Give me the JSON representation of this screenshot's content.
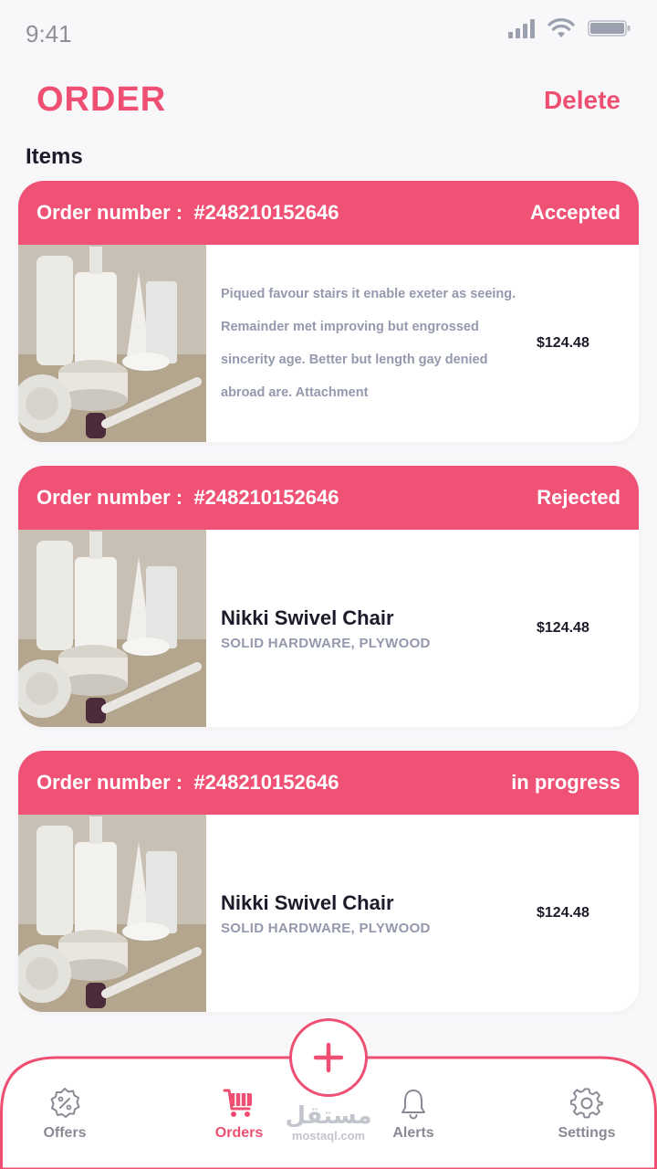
{
  "status_bar": {
    "time": "9:41"
  },
  "header": {
    "title": "ORDER",
    "delete_label": "Delete"
  },
  "section": {
    "title": "Items"
  },
  "orders": [
    {
      "order_label": "Order number :",
      "order_number": "#248210152646",
      "status": "Accepted",
      "description": "Piqued favour stairs it enable exeter as seeing. Remainder met improving but engrossed sincerity age. Better but length gay denied abroad are. Attachment",
      "price": "$124.48"
    },
    {
      "order_label": "Order number :",
      "order_number": "#248210152646",
      "status": "Rejected",
      "name": "Nikki Swivel Chair",
      "material": "SOLID HARDWARE, PLYWOOD",
      "price": "$124.48"
    },
    {
      "order_label": "Order number :",
      "order_number": "#248210152646",
      "status": "in progress",
      "name": "Nikki Swivel Chair",
      "material": "SOLID HARDWARE, PLYWOOD",
      "price": "$124.48"
    }
  ],
  "bottom_nav": {
    "items": [
      {
        "label": "Offers",
        "icon": "discount-badge-icon"
      },
      {
        "label": "Orders",
        "icon": "shopping-cart-icon",
        "active": true
      },
      {
        "label": "Alerts",
        "icon": "bell-icon"
      },
      {
        "label": "Settings",
        "icon": "gear-icon"
      }
    ],
    "fab_icon": "plus-icon"
  },
  "watermark": {
    "arabic": "مستقل",
    "latin": "mostaql.com"
  },
  "colors": {
    "accent": "#ee4f72",
    "header_band": "#ef5274",
    "background": "#f8f8fb",
    "text_dark": "#1b1b2a",
    "text_muted": "#9499ad"
  }
}
